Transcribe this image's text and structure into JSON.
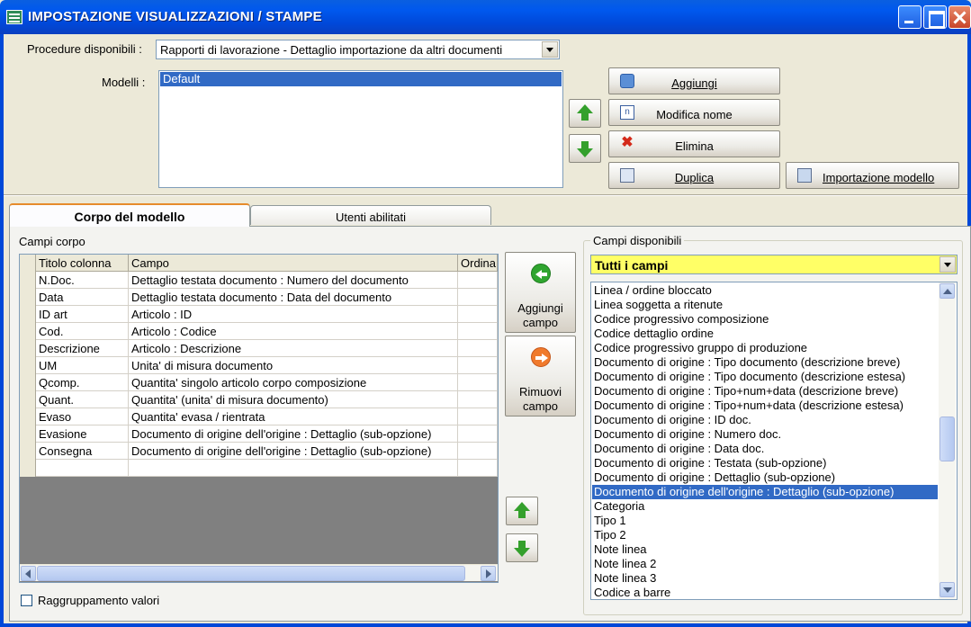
{
  "window": {
    "title": "IMPOSTAZIONE VISUALIZZAZIONI / STAMPE"
  },
  "procedures": {
    "label": "Procedure disponibili :",
    "selected": "Rapporti di lavorazione - Dettaglio importazione da altri documenti"
  },
  "models": {
    "label": "Modelli :",
    "items": [
      "Default"
    ],
    "selected_index": 0
  },
  "buttons": {
    "add": "Aggiungi",
    "rename": "Modifica nome",
    "delete": "Elimina",
    "duplicate": "Duplica",
    "import": "Importazione modello"
  },
  "tabs": [
    {
      "label": "Corpo del modello",
      "active": true
    },
    {
      "label": "Utenti abilitati",
      "active": false
    }
  ],
  "body_fields": {
    "label": "Campi corpo",
    "columns": [
      "Titolo colonna",
      "Campo",
      "Ordina"
    ],
    "rows": [
      [
        "N.Doc.",
        "Dettaglio testata documento : Numero del documento"
      ],
      [
        "Data",
        "Dettaglio testata documento : Data del documento"
      ],
      [
        "ID art",
        "Articolo : ID"
      ],
      [
        "Cod.",
        "Articolo : Codice"
      ],
      [
        "Descrizione",
        "Articolo : Descrizione"
      ],
      [
        "UM",
        "Unita' di misura documento"
      ],
      [
        "Qcomp.",
        "Quantita' singolo articolo corpo composizione"
      ],
      [
        "Quant.",
        "Quantita' (unita' di misura documento)"
      ],
      [
        "Evaso",
        "Quantita' evasa / rientrata"
      ],
      [
        "Evasione",
        "Documento di origine dell'origine : Dettaglio (sub-opzione)"
      ],
      [
        "Consegna",
        "Documento di origine dell'origine : Dettaglio (sub-opzione)"
      ]
    ]
  },
  "add_field_btn": {
    "line1": "Aggiungi",
    "line2": "campo"
  },
  "remove_field_btn": {
    "line1": "Rimuovi",
    "line2": "campo"
  },
  "group_values": {
    "label": "Raggruppamento valori",
    "checked": false
  },
  "available_fields": {
    "label": "Campi disponibili",
    "filter": "Tutti i campi",
    "filter_color": "#FFFF66",
    "items": [
      "Linea / ordine bloccato",
      "Linea soggetta a ritenute",
      "Codice progressivo composizione",
      "Codice dettaglio ordine",
      "Codice progressivo gruppo di produzione",
      "Documento di origine : Tipo documento (descrizione breve)",
      "Documento di origine : Tipo documento (descrizione estesa)",
      "Documento di origine : Tipo+num+data (descrizione breve)",
      "Documento di origine : Tipo+num+data (descrizione estesa)",
      "Documento di origine : ID doc.",
      "Documento di origine : Numero doc.",
      "Documento di origine : Data doc.",
      "Documento di origine : Testata (sub-opzione)",
      "Documento di origine : Dettaglio (sub-opzione)",
      "Documento di origine dell'origine : Dettaglio (sub-opzione)",
      "Categoria",
      "Tipo 1",
      "Tipo 2",
      "Note linea",
      "Note linea 2",
      "Note linea 3",
      "Codice a barre"
    ],
    "selected_index": 14
  },
  "colors": {
    "selection": "#316AC5",
    "titlebar": "#0058EE",
    "arrow": "#34A02C"
  }
}
